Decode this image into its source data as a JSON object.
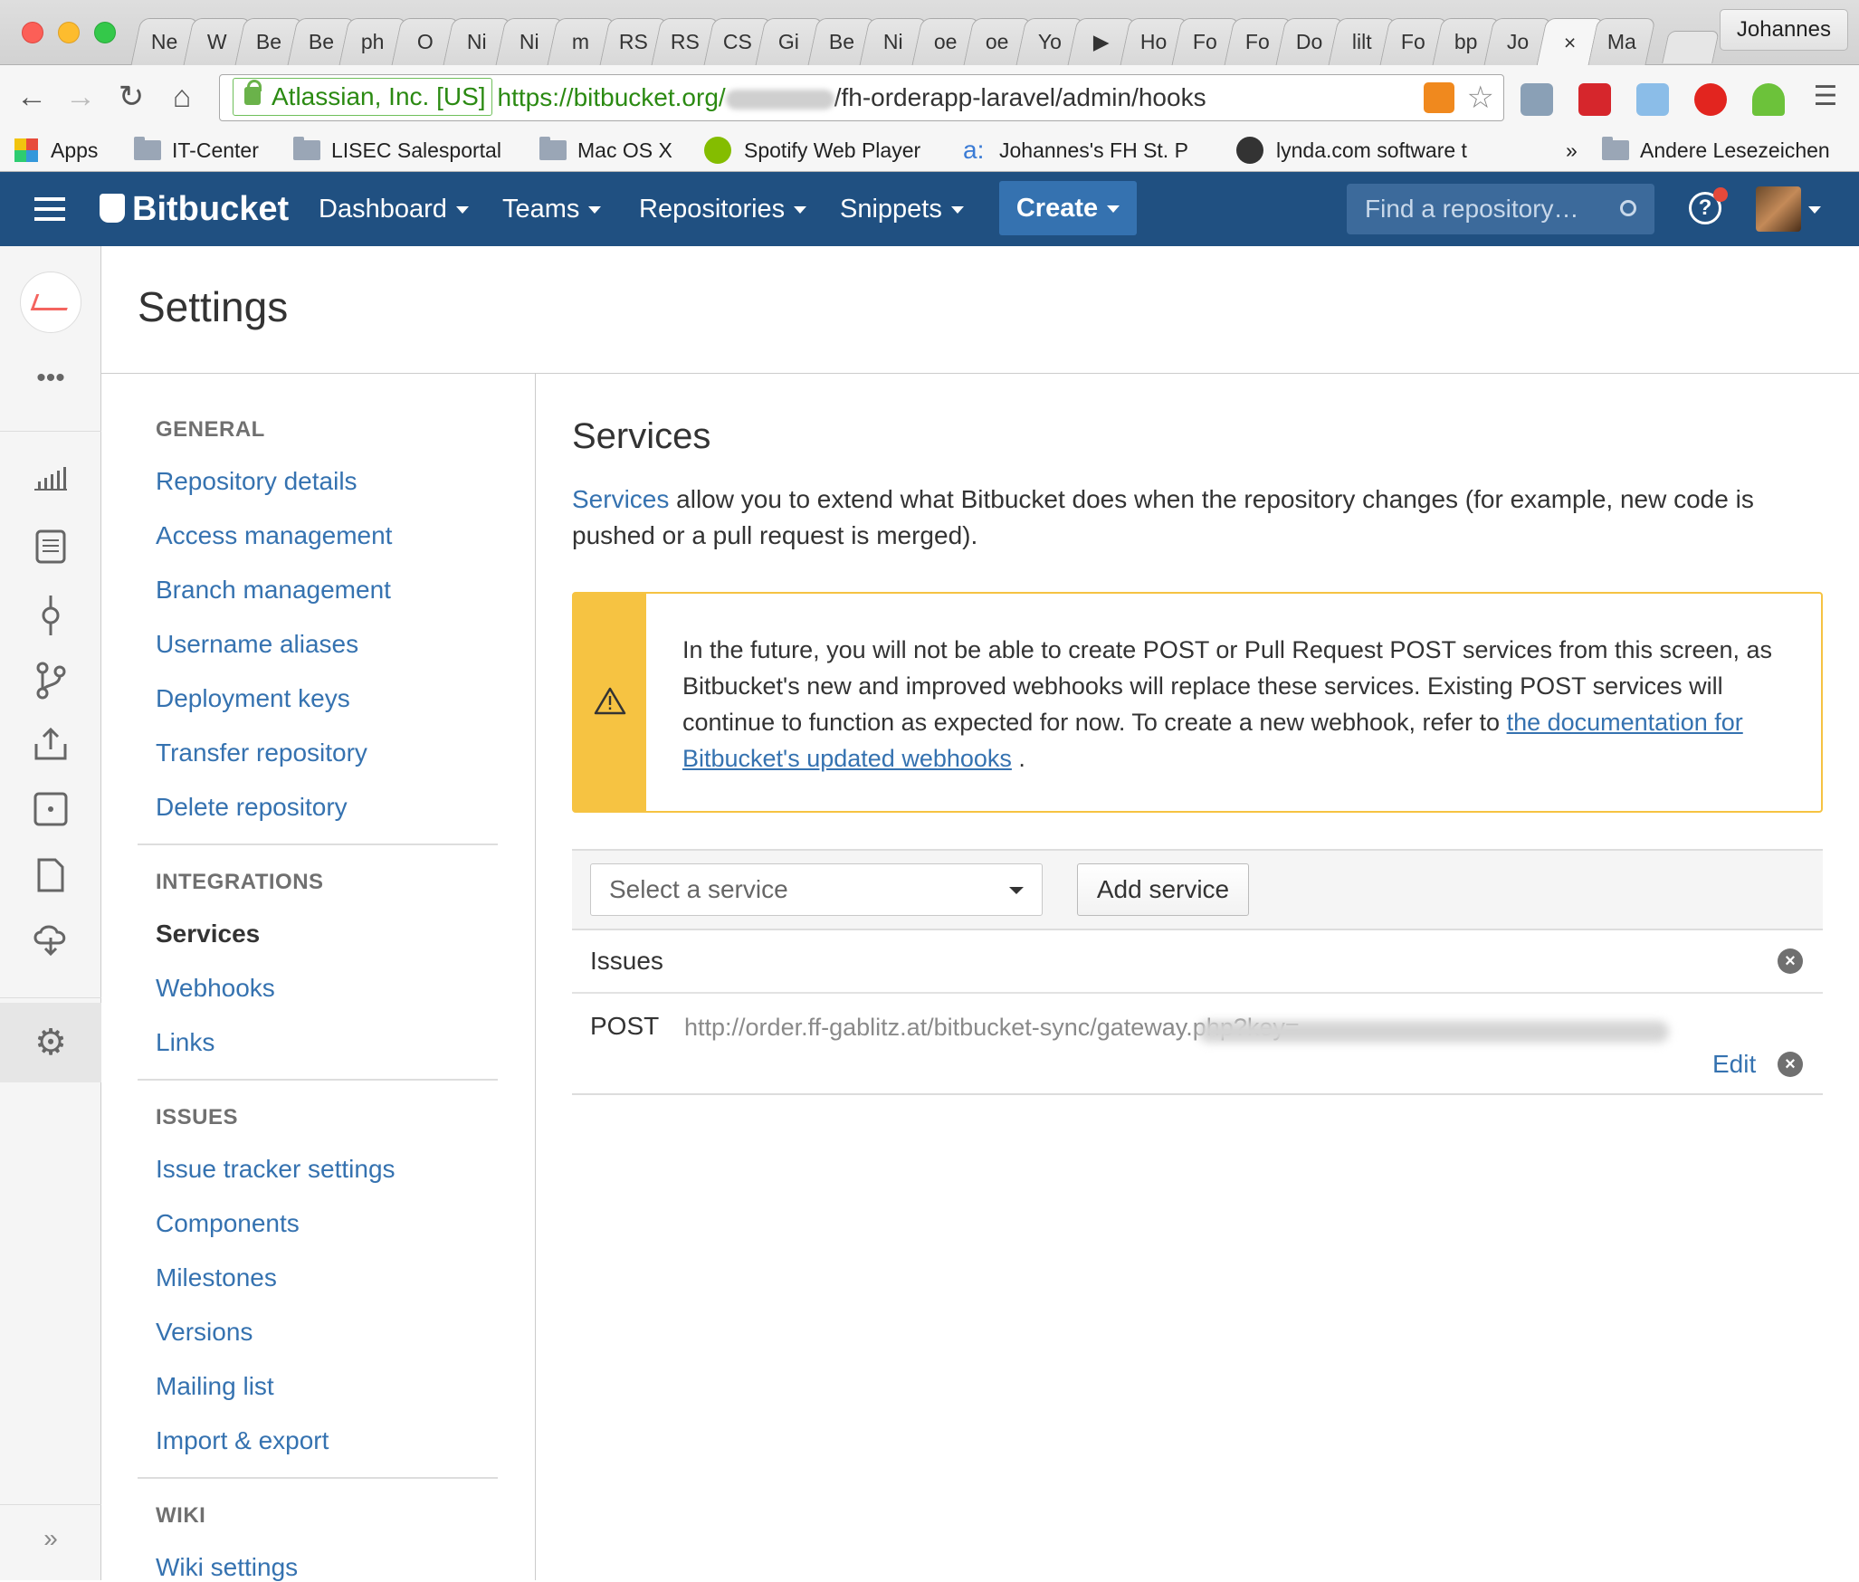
{
  "browser": {
    "tabs": [
      "Ne",
      "W",
      "Be",
      "Be",
      "ph",
      "O",
      "Ni",
      "Ni",
      "m",
      "RS",
      "RS",
      "CS",
      "Gi",
      "Be",
      "Ni",
      "oe",
      "oe",
      "Yo",
      "▶",
      "Ho",
      "Fo",
      "Fo",
      "Do",
      "lilt",
      "Fo",
      "bp",
      "Jo",
      "×",
      "Ma"
    ],
    "profile": "Johannes",
    "address": {
      "ev_label": "Atlassian, Inc. [US]",
      "scheme_host": "https://bitbucket.org/",
      "path": "/fh-orderapp-laravel/admin/hooks"
    },
    "bookmarks": [
      "Apps",
      "IT-Center",
      "LISEC Salesportal",
      "Mac OS X",
      "Spotify Web Player",
      "Johannes's FH St. P",
      "lynda.com software t",
      "»",
      "Andere Lesezeichen"
    ]
  },
  "header": {
    "brand": "Bitbucket",
    "nav": [
      "Dashboard",
      "Teams",
      "Repositories",
      "Snippets"
    ],
    "create": "Create",
    "search_placeholder": "Find a repository…"
  },
  "page": {
    "title": "Settings"
  },
  "sidebar": {
    "general": {
      "heading": "GENERAL",
      "items": [
        "Repository details",
        "Access management",
        "Branch management",
        "Username aliases",
        "Deployment keys",
        "Transfer repository",
        "Delete repository"
      ]
    },
    "integrations": {
      "heading": "INTEGRATIONS",
      "items": [
        "Services",
        "Webhooks",
        "Links"
      ]
    },
    "issues": {
      "heading": "ISSUES",
      "items": [
        "Issue tracker settings",
        "Components",
        "Milestones",
        "Versions",
        "Mailing list",
        "Import & export"
      ]
    },
    "wiki": {
      "heading": "WIKI",
      "items": [
        "Wiki settings"
      ]
    }
  },
  "main": {
    "title": "Services",
    "intro_link": "Services",
    "intro_rest": " allow you to extend what Bitbucket does when the repository changes (for example, new code is pushed or a pull request is merged).",
    "warning_text": "In the future, you will not be able to create POST or Pull Request POST services from this screen, as Bitbucket's new and improved webhooks will replace these services. Existing POST services will continue to function as expected for now. To create a new webhook, refer to ",
    "warning_link": "the documentation for Bitbucket's updated webhooks",
    "warning_end": " .",
    "select_placeholder": "Select a service",
    "add_button": "Add service",
    "services": [
      {
        "name": "Issues"
      },
      {
        "name": "POST",
        "url": "http://order.ff-gablitz.at/bitbucket-sync/gateway.php?key=",
        "edit": "Edit"
      }
    ]
  },
  "colors": {
    "header": "#205081",
    "link": "#3572b0",
    "warning": "#f6c342"
  }
}
